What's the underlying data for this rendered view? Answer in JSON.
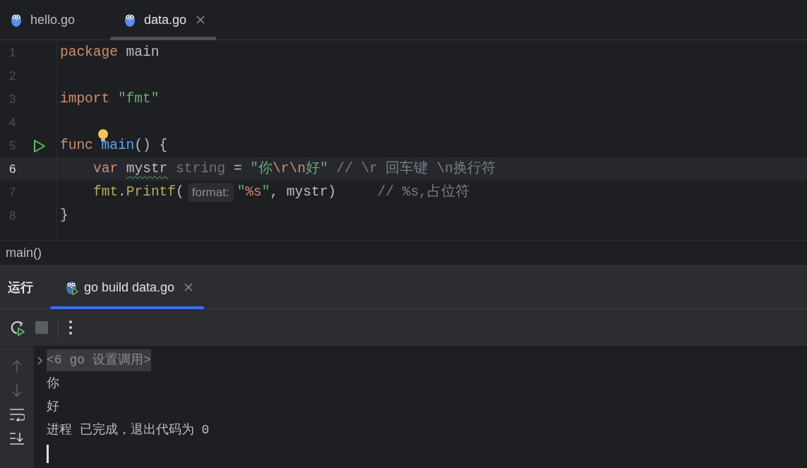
{
  "tabs": [
    {
      "label": "hello.go",
      "selected": false
    },
    {
      "label": "data.go",
      "selected": true
    }
  ],
  "editor": {
    "lines": [
      {
        "number": "1",
        "current": false,
        "run_marker": false,
        "indented": false,
        "tokens": [
          {
            "kind": "keyword",
            "text": "package"
          },
          {
            "kind": "plain",
            "text": " main"
          }
        ]
      },
      {
        "number": "2",
        "current": false,
        "run_marker": false
      },
      {
        "number": "3",
        "current": false,
        "run_marker": false,
        "indented": false,
        "tokens": [
          {
            "kind": "keyword",
            "text": "import "
          },
          {
            "kind": "string",
            "text": "\"fmt\""
          }
        ]
      },
      {
        "number": "4",
        "current": false,
        "run_marker": false
      },
      {
        "number": "5",
        "current": false,
        "run_marker": true,
        "indented": false,
        "tokens": [
          {
            "kind": "keyword",
            "text": "func "
          },
          {
            "kind": "bulb"
          },
          {
            "kind": "function",
            "text": "main"
          },
          {
            "kind": "plain",
            "text": "() {"
          }
        ]
      },
      {
        "number": "6",
        "current": true,
        "run_marker": false,
        "indented": true,
        "tokens": [
          {
            "kind": "keyword",
            "text": "var "
          },
          {
            "kind": "warning",
            "text": "mystr"
          },
          {
            "kind": "hint_type",
            "text": " string"
          },
          {
            "kind": "plain",
            "text": " = "
          },
          {
            "kind": "string",
            "text": "\"你"
          },
          {
            "kind": "escape",
            "text": "\\r\\n"
          },
          {
            "kind": "string",
            "text": "好\""
          },
          {
            "kind": "comment",
            "text": " // \\r 回车键 \\n换行符"
          }
        ]
      },
      {
        "number": "7",
        "current": false,
        "run_marker": false,
        "indented": true,
        "tokens": [
          {
            "kind": "package",
            "text": "fmt"
          },
          {
            "kind": "plain",
            "text": "."
          },
          {
            "kind": "package",
            "text": "Printf"
          },
          {
            "kind": "plain",
            "text": "("
          },
          {
            "kind": "inlay",
            "text": "format:"
          },
          {
            "kind": "string",
            "text": "\""
          },
          {
            "kind": "escape",
            "text": "%s"
          },
          {
            "kind": "string",
            "text": "\""
          },
          {
            "kind": "plain",
            "text": ", mystr)     "
          },
          {
            "kind": "comment",
            "text": "// %s,占位符"
          }
        ]
      },
      {
        "number": "8",
        "current": false,
        "run_marker": false,
        "indented": false,
        "tokens": [
          {
            "kind": "plain",
            "text": "}"
          }
        ]
      }
    ]
  },
  "breadcrumb": "main()",
  "run_panel": {
    "title": "运行",
    "tabs": [
      {
        "label": "go build data.go",
        "selected": true
      }
    ],
    "console": [
      {
        "kind": "folded",
        "text": "<6 go 设置调用>"
      },
      {
        "kind": "output",
        "text": "你"
      },
      {
        "kind": "output",
        "text": "好"
      },
      {
        "kind": "output",
        "text": "进程 已完成，退出代码为 0"
      },
      {
        "kind": "cursor"
      }
    ]
  }
}
